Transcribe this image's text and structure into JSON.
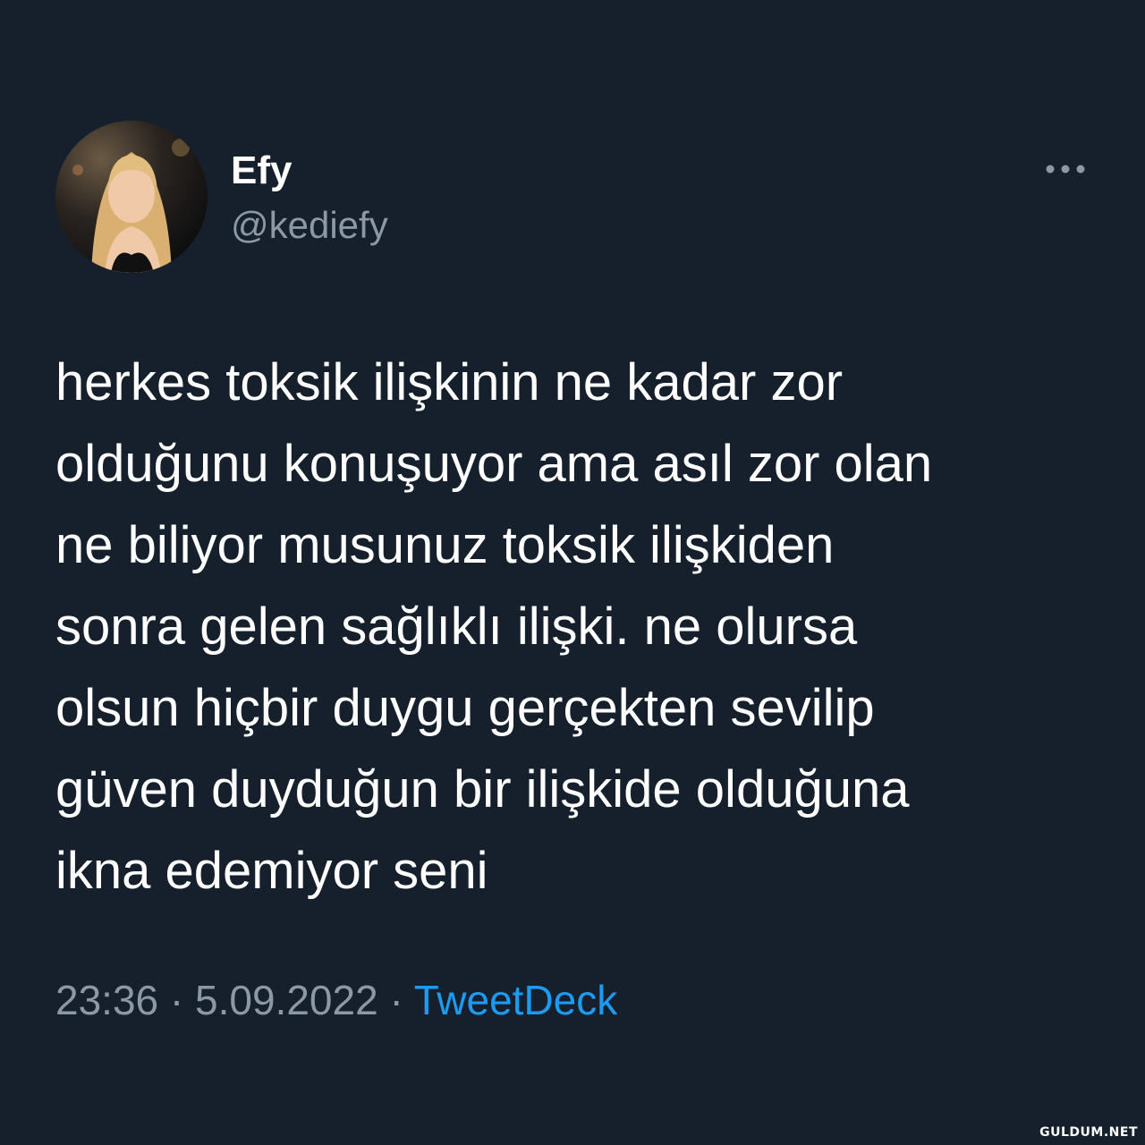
{
  "tweet": {
    "author": {
      "name": "Efy",
      "handle": "@kediefy",
      "avatar_icon": "profile-photo"
    },
    "more_icon": "more-horizontal-icon",
    "text_lines": [
      "herkes toksik ilişkinin ne kadar zor",
      "olduğunu konuşuyor ama asıl zor olan",
      "ne biliyor musunuz toksik ilişkiden",
      "sonra gelen sağlıklı ilişki. ne olursa",
      "olsun hiçbir duygu gerçekten sevilip",
      "güven duyduğun bir ilişkide olduğuna",
      "ikna edemiyor seni"
    ],
    "time": "23:36",
    "separator": "·",
    "date": "5.09.2022",
    "source": "TweetDeck"
  },
  "watermark": "GULDUM.NET",
  "colors": {
    "background": "#16202c",
    "text": "#ffffff",
    "secondary": "#8b98a5",
    "accent": "#1d9bf0"
  }
}
